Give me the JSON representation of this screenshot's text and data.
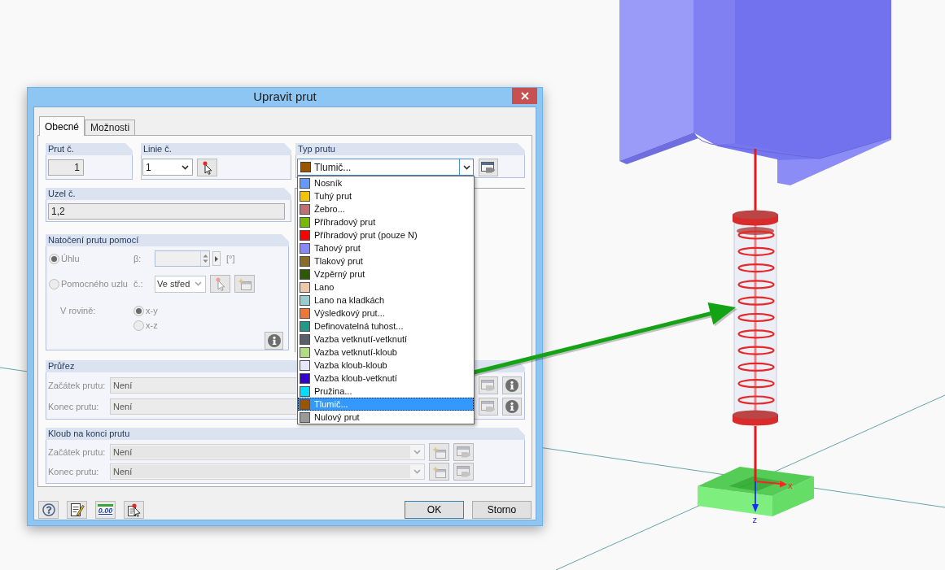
{
  "window": {
    "title": "Upravit prut"
  },
  "tabs": [
    {
      "label": "Obecné",
      "selected": true
    },
    {
      "label": "Možnosti",
      "selected": false
    }
  ],
  "member_no": {
    "label": "Prut č.",
    "value": "1"
  },
  "line_no": {
    "label": "Linie č.",
    "value": "1"
  },
  "member_type": {
    "label": "Typ prutu",
    "value": "Tlumič...",
    "color": "#995500",
    "expanded": true,
    "options": [
      {
        "label": "Nosník",
        "color": "#6699ff",
        "selected": false
      },
      {
        "label": "Tuhý prut",
        "color": "#f5c400",
        "selected": false
      },
      {
        "label": "Žebro...",
        "color": "#c07070",
        "selected": false
      },
      {
        "label": "Příhradový prut",
        "color": "#77bb00",
        "selected": false
      },
      {
        "label": "Příhradový prut (pouze N)",
        "color": "#ff0000",
        "selected": false
      },
      {
        "label": "Tahový prut",
        "color": "#8888ff",
        "selected": false
      },
      {
        "label": "Tlakový prut",
        "color": "#8b6a2a",
        "selected": false
      },
      {
        "label": "Vzpěrný prut",
        "color": "#2d5a00",
        "selected": false
      },
      {
        "label": "Lano",
        "color": "#eec8a8",
        "selected": false
      },
      {
        "label": "Lano na kladkách",
        "color": "#99cccc",
        "selected": false
      },
      {
        "label": "Výsledkový prut...",
        "color": "#ee7733",
        "selected": false
      },
      {
        "label": "Definovatelná tuhost...",
        "color": "#229988",
        "selected": false
      },
      {
        "label": "Vazba vetknutí-vetknutí",
        "color": "#5a5f6a",
        "selected": false
      },
      {
        "label": "Vazba vetknutí-kloub",
        "color": "#b0dd80",
        "selected": false
      },
      {
        "label": "Vazba kloub-kloub",
        "color": "#e6e6ff",
        "selected": false
      },
      {
        "label": "Vazba kloub-vetknutí",
        "color": "#3300cc",
        "selected": false
      },
      {
        "label": "Pružina...",
        "color": "#00ddff",
        "selected": false
      },
      {
        "label": "Tlumič...",
        "color": "#995500",
        "selected": true
      },
      {
        "label": "Nulový prut",
        "color": "#999999",
        "selected": false
      }
    ]
  },
  "node_no": {
    "label": "Uzel č.",
    "value": "1,2"
  },
  "rotation": {
    "title": "Natočení prutu pomocí",
    "disabled": true,
    "options": [
      {
        "kind": "angle",
        "label": "Úhlu",
        "selected": true,
        "field_label": "β:",
        "unit": "[°]"
      },
      {
        "kind": "node",
        "label": "Pomocného uzlu",
        "selected": false,
        "field_label": "č.:",
        "value": "Ve střed"
      }
    ],
    "plane": {
      "label": "V rovině:",
      "options": [
        {
          "label": "x-y",
          "selected": true
        },
        {
          "label": "x-z",
          "selected": false
        }
      ]
    }
  },
  "cross_section": {
    "title": "Průřez",
    "disabled": true,
    "rows": [
      {
        "label": "Začátek prutu:",
        "value": "Není"
      },
      {
        "label": "Konec prutu:",
        "value": "Není"
      }
    ]
  },
  "end_hinge": {
    "title": "Kloub na konci prutu",
    "disabled": true,
    "rows": [
      {
        "label": "Začátek prutu:",
        "value": "Není"
      },
      {
        "label": "Konec prutu:",
        "value": "Není"
      }
    ]
  },
  "decimals_button": {
    "label": "0.00"
  },
  "buttons": [
    {
      "label": "OK",
      "default": true
    },
    {
      "label": "Storno",
      "default": false
    }
  ],
  "model_view": {
    "axes": [
      {
        "kind": "x",
        "label": "x"
      },
      {
        "kind": "z",
        "label": "z"
      }
    ]
  }
}
